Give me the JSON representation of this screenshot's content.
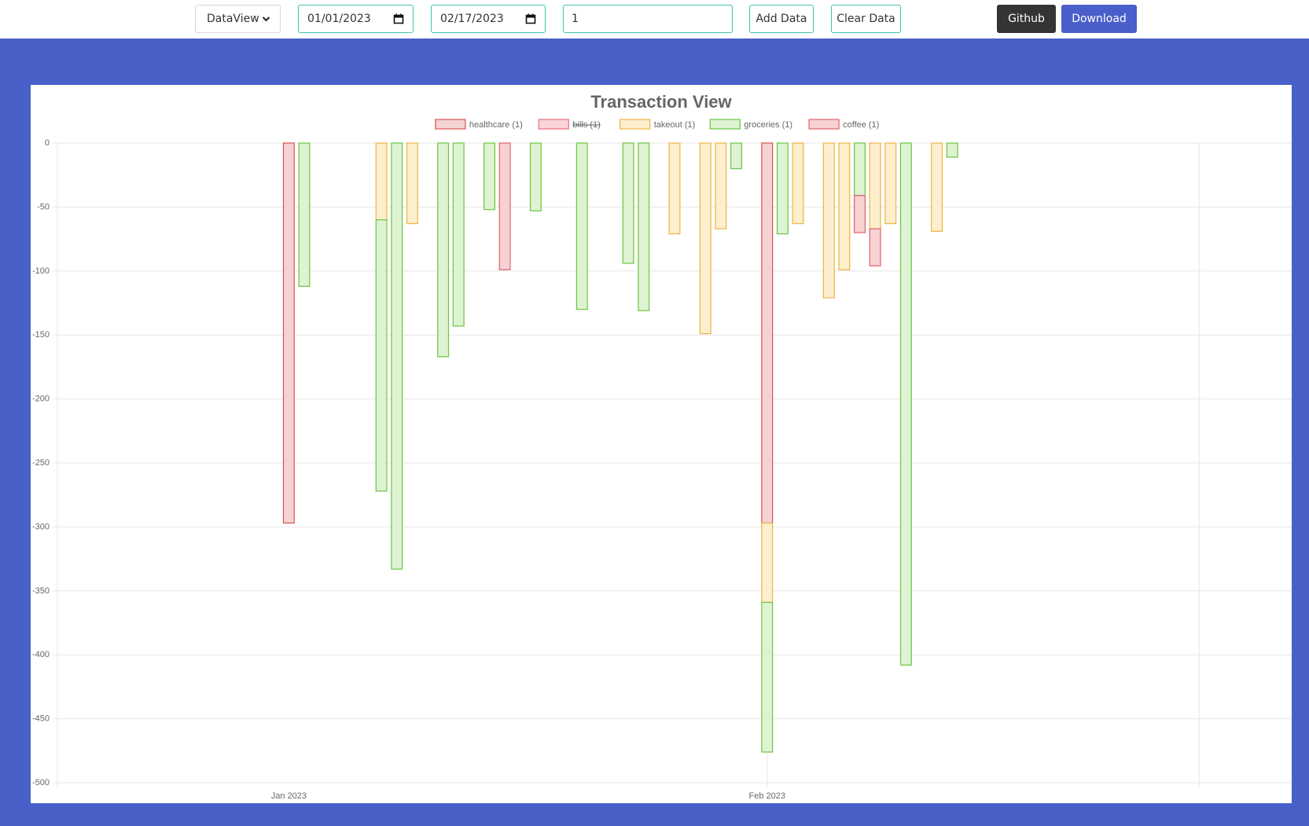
{
  "toolbar": {
    "view_select": "DataView",
    "start_date": "01/01/2023",
    "end_date": "02/17/2023",
    "amount_value": "1",
    "add_label": "Add Data",
    "clear_label": "Clear Data",
    "github_label": "Github",
    "download_label": "Download"
  },
  "colors": {
    "frame": "#4860c8",
    "teal_border": "#3fc3b4",
    "github_bg": "#343434",
    "download_bg": "#4a5fcb"
  },
  "chart_data": {
    "type": "bar",
    "stacked": true,
    "title": "Transaction View",
    "xlabel": "",
    "ylabel": "",
    "ylim": [
      -500,
      0
    ],
    "ytick_step": 50,
    "xlim": [
      "2022-12-17",
      "2023-03-07"
    ],
    "xticks": [
      {
        "date": "2023-01-01",
        "label": "Jan 2023"
      },
      {
        "date": "2023-02-01",
        "label": "Feb 2023"
      }
    ],
    "grid": true,
    "legend_position": "top",
    "series": [
      {
        "name": "healthcare (1)",
        "color": "#d9534f",
        "fill": "#f5d3d2",
        "hidden": false,
        "points": [
          {
            "x": "2023-01-01",
            "y": -297
          },
          {
            "x": "2023-02-01",
            "y": -297
          }
        ]
      },
      {
        "name": "bills (1)",
        "color": "#e86f7a",
        "fill": "#fad4d8",
        "hidden": true,
        "points": []
      },
      {
        "name": "takeout (1)",
        "color": "#eeb342",
        "fill": "#fdefcd",
        "points": [
          {
            "x": "2023-01-07",
            "y": -60
          },
          {
            "x": "2023-01-09",
            "y": -63
          },
          {
            "x": "2023-01-26",
            "y": -71
          },
          {
            "x": "2023-01-28",
            "y": -149
          },
          {
            "x": "2023-01-29",
            "y": -67
          },
          {
            "x": "2023-02-01",
            "y": -62
          },
          {
            "x": "2023-02-03",
            "y": -63
          },
          {
            "x": "2023-02-05",
            "y": -121
          },
          {
            "x": "2023-02-06",
            "y": -99
          },
          {
            "x": "2023-02-08",
            "y": -67
          },
          {
            "x": "2023-02-09",
            "y": -63
          },
          {
            "x": "2023-02-12",
            "y": -69
          }
        ]
      },
      {
        "name": "groceries (1)",
        "color": "#6cc544",
        "fill": "#ddf3d1",
        "points": [
          {
            "x": "2023-01-02",
            "y": -112
          },
          {
            "x": "2023-01-07",
            "y": -212
          },
          {
            "x": "2023-01-08",
            "y": -333
          },
          {
            "x": "2023-01-11",
            "y": -167
          },
          {
            "x": "2023-01-12",
            "y": -143
          },
          {
            "x": "2023-01-14",
            "y": -52
          },
          {
            "x": "2023-01-17",
            "y": -53
          },
          {
            "x": "2023-01-20",
            "y": -130
          },
          {
            "x": "2023-01-23",
            "y": -94
          },
          {
            "x": "2023-01-24",
            "y": -131
          },
          {
            "x": "2023-01-30",
            "y": -20
          },
          {
            "x": "2023-02-01",
            "y": -117
          },
          {
            "x": "2023-02-02",
            "y": -71
          },
          {
            "x": "2023-02-07",
            "y": -41
          },
          {
            "x": "2023-02-10",
            "y": -408
          },
          {
            "x": "2023-02-13",
            "y": -11
          }
        ]
      },
      {
        "name": "coffee (1)",
        "color": "#e0626b",
        "fill": "#f8d1d3",
        "points": [
          {
            "x": "2023-01-15",
            "y": -99
          },
          {
            "x": "2023-02-07",
            "y": -29
          },
          {
            "x": "2023-02-08",
            "y": -29
          }
        ]
      }
    ]
  }
}
